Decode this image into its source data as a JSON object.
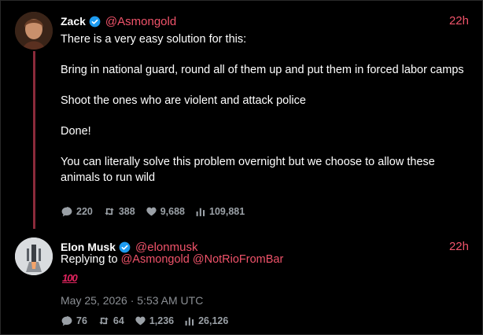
{
  "thread": {
    "main_post": {
      "author_name": "Zack",
      "author_handle": "@Asmongold",
      "time_ago": "22h",
      "body_lines": [
        "There is a very easy solution for this:",
        "Bring in national guard, round all of them up and put them in forced labor camps",
        "Shoot the ones who are violent and attack police",
        "Done!",
        "You can literally solve this problem overnight but we choose to allow these animals to run wild"
      ],
      "metrics": {
        "replies": "220",
        "reposts": "388",
        "likes": "9,688",
        "views": "109,881"
      }
    },
    "reply_post": {
      "author_name": "Elon Musk",
      "author_handle": "@elonmusk",
      "time_ago": "22h",
      "replying_to_label": "Replying to",
      "replying_to": [
        "@Asmongold",
        "@NotRioFromBar"
      ],
      "content_emoji": "100",
      "timestamp": "May 25, 2026 · 5:53 AM UTC",
      "metrics": {
        "replies": "76",
        "reposts": "64",
        "likes": "1,236",
        "views": "26,126"
      }
    }
  },
  "colors": {
    "accent": "#f0536a",
    "background": "#000000",
    "verified": "#1d9bf0",
    "thread_line": "#8b2a3a",
    "metric": "#9aa0a6"
  },
  "icons": {
    "replies": "comment-icon",
    "reposts": "repost-icon",
    "likes": "heart-icon",
    "views": "views-icon",
    "verified": "verified-badge-icon"
  }
}
